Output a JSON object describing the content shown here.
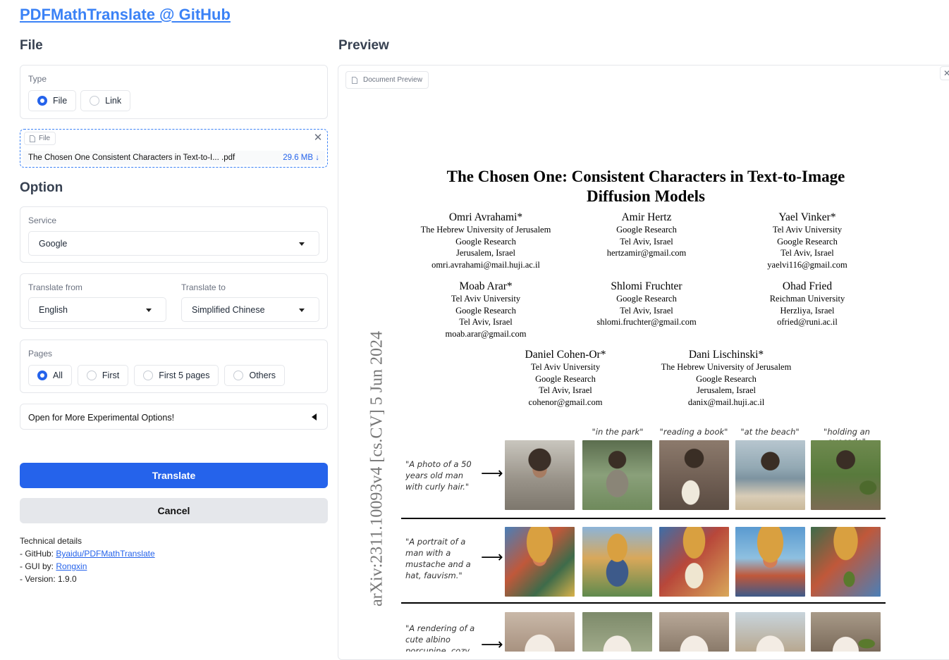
{
  "app_title": "PDFMathTranslate @ GitHub",
  "colors": {
    "primary": "#2563eb",
    "link": "#3b82f6",
    "cancel_bg": "#e5e7eb"
  },
  "file_section": {
    "title": "File",
    "type_label": "Type",
    "type_options": [
      "File",
      "Link"
    ],
    "type_selected": "File",
    "upload_label": "File",
    "file_name": "The Chosen One Consistent Characters in Text-to-I... .pdf",
    "file_size": "29.6 MB ↓"
  },
  "option_section": {
    "title": "Option",
    "service_label": "Service",
    "service_value": "Google",
    "translate_from_label": "Translate from",
    "translate_from_value": "English",
    "translate_to_label": "Translate to",
    "translate_to_value": "Simplified Chinese",
    "pages_label": "Pages",
    "pages_options": [
      "All",
      "First",
      "First 5 pages",
      "Others"
    ],
    "pages_selected": "All",
    "experimental_label": "Open for More Experimental Options!"
  },
  "actions": {
    "translate": "Translate",
    "cancel": "Cancel"
  },
  "technical": {
    "heading": "Technical details",
    "github_prefix": "- GitHub: ",
    "github_link": "Byaidu/PDFMathTranslate",
    "gui_prefix": "- GUI by: ",
    "gui_link": "Rongxin",
    "version": "- Version: 1.9.0"
  },
  "preview": {
    "title": "Preview",
    "tab_label": "Document Preview",
    "paper": {
      "title_line1": "The Chosen One: Consistent Characters in Text-to-Image",
      "title_line2": "Diffusion Models",
      "arxiv_stamp": "arXiv:2311.10093v4  [cs.CV]  5 Jun 2024",
      "authors": [
        {
          "name": "Omri Avrahami*",
          "lines": [
            "The Hebrew University of Jerusalem",
            "Google Research",
            "Jerusalem, Israel",
            "omri.avrahami@mail.huji.ac.il"
          ]
        },
        {
          "name": "Amir Hertz",
          "lines": [
            "Google Research",
            "Tel Aviv, Israel",
            "hertzamir@gmail.com"
          ]
        },
        {
          "name": "Yael Vinker*",
          "lines": [
            "Tel Aviv University",
            "Google Research",
            "Tel Aviv, Israel",
            "yaelvi116@gmail.com"
          ]
        },
        {
          "name": "Moab Arar*",
          "lines": [
            "Tel Aviv University",
            "Google Research",
            "Tel Aviv, Israel",
            "moab.arar@gmail.com"
          ]
        },
        {
          "name": "Shlomi Fruchter",
          "lines": [
            "Google Research",
            "Tel Aviv, Israel",
            "shlomi.fruchter@gmail.com"
          ]
        },
        {
          "name": "Ohad Fried",
          "lines": [
            "Reichman University",
            "Herzliya, Israel",
            "ofried@runi.ac.il"
          ]
        },
        {
          "name": "Daniel Cohen-Or*",
          "lines": [
            "Tel Aviv University",
            "Google Research",
            "Tel Aviv, Israel",
            "cohenor@gmail.com"
          ]
        },
        {
          "name": "Dani Lischinski*",
          "lines": [
            "The Hebrew University of Jerusalem",
            "Google Research",
            "Jerusalem, Israel",
            "danix@mail.huji.ac.il"
          ]
        }
      ],
      "captions": [
        "\"in the park\"",
        "\"reading a book\"",
        "\"at the beach\"",
        "\"holding an avocado\""
      ],
      "prompts": [
        "\"A photo of a 50 years old man with curly hair.\"",
        "\"A portrait of a man with a mustache and a hat, fauvism.\"",
        "\"A rendering of a cute albino porcupine, cozy"
      ]
    }
  }
}
